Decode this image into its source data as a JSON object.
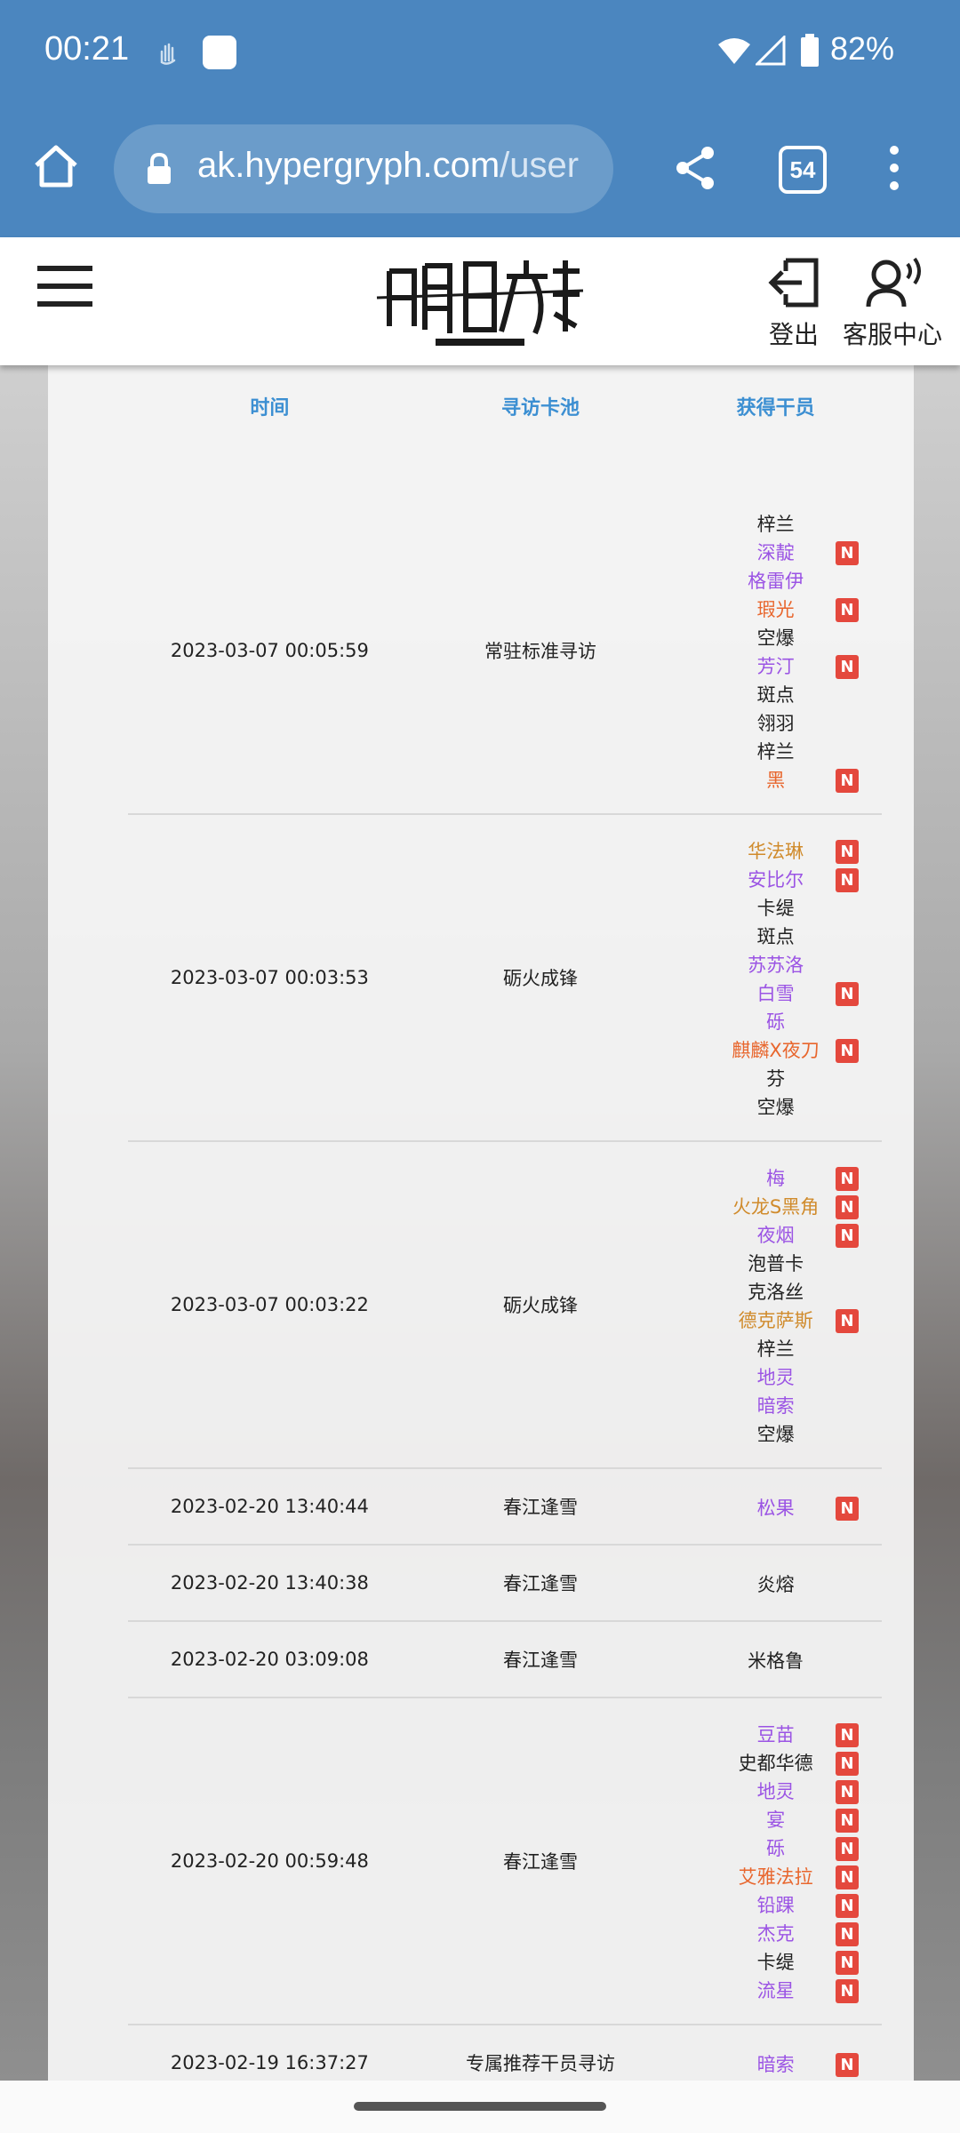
{
  "status_bar": {
    "time": "00:21",
    "battery": "82%"
  },
  "browser": {
    "url_host": "ak.hypergryph.com",
    "url_path": "/user",
    "tab_count": "54"
  },
  "header": {
    "logout_label": "登出",
    "service_label": "客服中心"
  },
  "table": {
    "headers": [
      "时间",
      "寻访卡池",
      "获得干员"
    ],
    "rows": [
      {
        "time": "2023-03-07 00:05:59",
        "pool": "常驻标准寻访",
        "ops": [
          {
            "name": "梓兰",
            "rarity": 3,
            "new": ""
          },
          {
            "name": "深靛",
            "rarity": 4,
            "new": "N"
          },
          {
            "name": "格雷伊",
            "rarity": 4,
            "new": ""
          },
          {
            "name": "瑕光",
            "rarity": 6,
            "new": "N"
          },
          {
            "name": "空爆",
            "rarity": 3,
            "new": ""
          },
          {
            "name": "芳汀",
            "rarity": 4,
            "new": "N"
          },
          {
            "name": "斑点",
            "rarity": 3,
            "new": ""
          },
          {
            "name": "翎羽",
            "rarity": 3,
            "new": ""
          },
          {
            "name": "梓兰",
            "rarity": 3,
            "new": ""
          },
          {
            "name": "黑",
            "rarity": 6,
            "new": "N"
          }
        ]
      },
      {
        "time": "2023-03-07 00:03:53",
        "pool": "砺火成锋",
        "ops": [
          {
            "name": "华法琳",
            "rarity": 5,
            "new": "N"
          },
          {
            "name": "安比尔",
            "rarity": 4,
            "new": "N"
          },
          {
            "name": "卡缇",
            "rarity": 3,
            "new": ""
          },
          {
            "name": "斑点",
            "rarity": 3,
            "new": ""
          },
          {
            "name": "苏苏洛",
            "rarity": 4,
            "new": ""
          },
          {
            "name": "白雪",
            "rarity": 4,
            "new": "N"
          },
          {
            "name": "砾",
            "rarity": 4,
            "new": ""
          },
          {
            "name": "麒麟X夜刀",
            "rarity": 6,
            "new": "N"
          },
          {
            "name": "芬",
            "rarity": 3,
            "new": ""
          },
          {
            "name": "空爆",
            "rarity": 3,
            "new": ""
          }
        ]
      },
      {
        "time": "2023-03-07 00:03:22",
        "pool": "砺火成锋",
        "ops": [
          {
            "name": "梅",
            "rarity": 4,
            "new": "N"
          },
          {
            "name": "火龙S黑角",
            "rarity": 5,
            "new": "N"
          },
          {
            "name": "夜烟",
            "rarity": 4,
            "new": "N"
          },
          {
            "name": "泡普卡",
            "rarity": 3,
            "new": ""
          },
          {
            "name": "克洛丝",
            "rarity": 3,
            "new": ""
          },
          {
            "name": "德克萨斯",
            "rarity": 5,
            "new": "N"
          },
          {
            "name": "梓兰",
            "rarity": 3,
            "new": ""
          },
          {
            "name": "地灵",
            "rarity": 4,
            "new": ""
          },
          {
            "name": "暗索",
            "rarity": 4,
            "new": ""
          },
          {
            "name": "空爆",
            "rarity": 3,
            "new": ""
          }
        ]
      },
      {
        "time": "2023-02-20 13:40:44",
        "pool": "春江逢雪",
        "ops": [
          {
            "name": "松果",
            "rarity": 4,
            "new": "N"
          }
        ]
      },
      {
        "time": "2023-02-20 13:40:38",
        "pool": "春江逢雪",
        "ops": [
          {
            "name": "炎熔",
            "rarity": 3,
            "new": ""
          }
        ]
      },
      {
        "time": "2023-02-20 03:09:08",
        "pool": "春江逢雪",
        "ops": [
          {
            "name": "米格鲁",
            "rarity": 3,
            "new": ""
          }
        ]
      },
      {
        "time": "2023-02-20 00:59:48",
        "pool": "春江逢雪",
        "ops": [
          {
            "name": "豆苗",
            "rarity": 4,
            "new": "N"
          },
          {
            "name": "史都华德",
            "rarity": 3,
            "new": "N"
          },
          {
            "name": "地灵",
            "rarity": 4,
            "new": "N"
          },
          {
            "name": "宴",
            "rarity": 4,
            "new": "N"
          },
          {
            "name": "砾",
            "rarity": 4,
            "new": "N"
          },
          {
            "name": "艾雅法拉",
            "rarity": 6,
            "new": "N"
          },
          {
            "name": "铅踝",
            "rarity": 4,
            "new": "N"
          },
          {
            "name": "杰克",
            "rarity": 4,
            "new": "N"
          },
          {
            "name": "卡缇",
            "rarity": 3,
            "new": "N"
          },
          {
            "name": "流星",
            "rarity": 4,
            "new": "N"
          }
        ]
      },
      {
        "time": "2023-02-19 16:37:27",
        "pool": "专属推荐干员寻访",
        "ops": [
          {
            "name": "暗索",
            "rarity": 4,
            "new": "N"
          }
        ]
      }
    ]
  },
  "colors": {
    "rarity3": "#222222",
    "rarity4": "#9b54e4",
    "rarity5": "#d08b2c",
    "rarity6": "#e8662d",
    "new_badge": "#e4483d",
    "header_text": "#3c8fd2",
    "browser_bar": "#4b86bf"
  }
}
